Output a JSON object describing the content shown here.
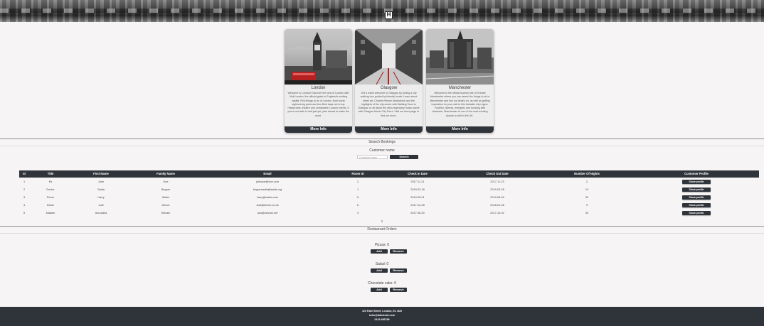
{
  "header": {
    "logo_letter": "H"
  },
  "cities": [
    {
      "name": "London",
      "description": "Welcome to London! Discover the best of London with Visit London, the official guide to England's exciting capital. Find things to do in London, from iconic sightseeing spots and fun-filled days out to top restaurants, theatre and unmissable London events. If you're not able to visit just yet, plan ahead to make the most.",
      "button": "More Info"
    },
    {
      "name": "Glasgow",
      "description": "Get a warm welcome to Glasgow by joining a city walking tour guided by friendly locals. Learn about street art, Charles Rennie Mackintosh and the highlights of the city centre with Walking Tours in Glasgow, or all about the city's legendary music scene with Glasgow Music City Tours. Visit our tours page to find out more.",
      "button": "More Info"
    },
    {
      "name": "Manchester",
      "description": "Welcome to the official tourism site of Greater Manchester where you can search for things to do in Manchester and find out what's on, as well as getting inspiration for your visit to this fantastic city region. Youthful, diverse, energetic and bursting with character, Manchester is one of the most exciting places to visit in the UK.",
      "button": "More Info"
    }
  ],
  "search": {
    "title": "Search Bookings",
    "label": "Customer name",
    "placeholder": "Customer name",
    "button": "Search"
  },
  "table": {
    "headers": [
      "Id",
      "Title",
      "First Name",
      "Family Name",
      "Email",
      "Room ID",
      "Check In Date",
      "Check Out Date",
      "Number Of Nights",
      "Customer Profile"
    ],
    "rows": [
      [
        "1",
        "Mr",
        "John",
        "Doe",
        "johndoe@doe.com",
        "2",
        "2017-11-21",
        "2017-11-23",
        "2",
        "Show profile"
      ],
      [
        "2",
        "Doctor",
        "Sadia",
        "Begum",
        "begumsadia@sadia.org",
        "1",
        "2019-03-18",
        "2019-03-28",
        "10",
        "Show profile"
      ],
      [
        "3",
        "Prince",
        "Harry",
        "Wales",
        "harry@wales.com",
        "5",
        "2019-05-01",
        "2019-06-09",
        "39",
        "Show profile"
      ],
      [
        "4",
        "Dame",
        "Judi",
        "Dench",
        "Judi@dench.co.uk",
        "6",
        "2017-12-28",
        "2018-01-06",
        "9",
        "Show profile"
      ],
      [
        "5",
        "Madam",
        "Anuradha",
        "Selvam",
        "anu@selvam.net",
        "3",
        "2017-08-30",
        "2017-10-02",
        "33",
        "Show profile"
      ]
    ],
    "pagination": "1"
  },
  "orders": {
    "title": "Restaurant Orders",
    "items": [
      {
        "label": "Pizzas: 0",
        "add": "Add",
        "remove": "Remove"
      },
      {
        "label": "Salad: 0",
        "add": "Add",
        "remove": "Remove"
      },
      {
        "label": "Chocolate cake: 0",
        "add": "Add",
        "remove": "Remove"
      }
    ]
  },
  "footer": {
    "address": "123 Fake Street, London, E1 4UD",
    "email": "hello@fakehotel.com",
    "phone": "0123 456789"
  },
  "colors": {
    "dark": "#2f333a",
    "background": "#f6f4f4"
  }
}
